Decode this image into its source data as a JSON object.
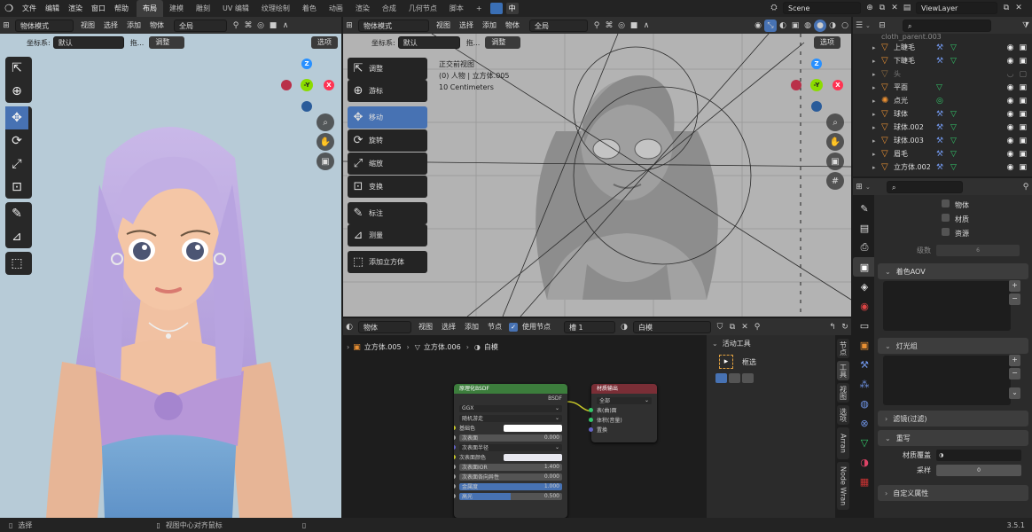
{
  "topbar": {
    "menus": [
      "文件",
      "编辑",
      "渲染",
      "窗口",
      "帮助"
    ],
    "workspaces": [
      "布局",
      "建模",
      "雕刻",
      "UV 编辑",
      "纹理绘制",
      "着色",
      "动画",
      "渲染",
      "合成",
      "几何节点",
      "脚本"
    ],
    "active_workspace": "布局",
    "lang_badge": "中",
    "scene": "Scene",
    "view_layer": "ViewLayer"
  },
  "viewport_left": {
    "mode": "物体模式",
    "menus": [
      "视图",
      "选择",
      "添加",
      "物体"
    ],
    "orientation": "全局",
    "coord_label": "坐标系:",
    "coord_value": "默认",
    "drag_label": "拖...",
    "adjust_label": "调整",
    "options_label": "选项",
    "gizmo": {
      "x": "X",
      "y": "Y",
      "z": "Z",
      "neg_y": "-Y"
    }
  },
  "viewport_right": {
    "mode": "物体模式",
    "menus": [
      "视图",
      "选择",
      "添加",
      "物体"
    ],
    "orientation": "全局",
    "coord_label": "坐标系:",
    "coord_value": "默认",
    "drag_label": "拖...",
    "adjust_label": "调整",
    "options_label": "选项",
    "info_line1": "正交前视图",
    "info_line2": "(0) 人物 | 立方体.005",
    "info_line3": "10 Centimeters",
    "tools": [
      "调整",
      "游标",
      "移动",
      "旋转",
      "缩放",
      "变换",
      "标注",
      "测量",
      "添加立方体"
    ],
    "active_tool": "移动"
  },
  "node_editor": {
    "editor_label": "物体",
    "menus": [
      "视图",
      "选择",
      "添加",
      "节点"
    ],
    "use_nodes": "使用节点",
    "slot": "槽 1",
    "material": "白模",
    "breadcrumb": [
      "立方体.005",
      "立方体.006",
      "白模"
    ],
    "bsdf": {
      "title": "原理化BSDF",
      "output": "BSDF",
      "distribution": "GGX",
      "subsurface_method": "随机游走",
      "base_color": "基础色",
      "subsurface": {
        "label": "次表面",
        "value": "0.000"
      },
      "subsurface_radius": "次表面半径",
      "subsurface_color": "次表面颜色",
      "subsurface_ior": {
        "label": "次表面IOR",
        "value": "1.400"
      },
      "subsurface_aniso": {
        "label": "次表面各向异性",
        "value": "0.000"
      },
      "metallic": {
        "label": "金属度",
        "value": "1.000"
      },
      "specular": {
        "label": "高光",
        "value": "0.500"
      }
    },
    "output_node": {
      "title": "材质输出",
      "target": "全部",
      "surface": "表(曲)面",
      "volume": "体积(音量)",
      "displacement": "置换"
    },
    "sidebar": {
      "title": "活动工具",
      "tool": "框选",
      "tabs": [
        "节点",
        "工具",
        "视图",
        "选项",
        "Arran",
        "Node Wran"
      ]
    }
  },
  "outliner": {
    "search_placeholder": "",
    "rows": [
      {
        "name": "cloth_parent.003",
        "faded": true
      },
      {
        "name": "上睫毛"
      },
      {
        "name": "下睫毛"
      },
      {
        "name": "头",
        "faded": true
      },
      {
        "name": "平面"
      },
      {
        "name": "点光"
      },
      {
        "name": "球体"
      },
      {
        "name": "球体.002"
      },
      {
        "name": "球体.003"
      },
      {
        "name": "眉毛"
      },
      {
        "name": "立方体.002"
      }
    ]
  },
  "properties": {
    "checkboxes": [
      "物体",
      "材质",
      "资源"
    ],
    "levels_label": "级数",
    "levels_value": "6",
    "sections": {
      "aov": "着色AOV",
      "light_group": "灯光组",
      "filter": "滤镜(过滤)",
      "override": "重写",
      "custom": "自定义属性"
    },
    "material_override": "材质覆盖",
    "samples_label": "采样",
    "samples_value": "0"
  },
  "statusbar": {
    "select": "选择",
    "center": "视图中心对齐鼠标",
    "version": "3.5.1"
  },
  "colors": {
    "accent": "#4772b3",
    "shader_header": "#3c7d3c",
    "output_header": "#7a2e36",
    "gizmo_x": "#ff3352",
    "gizmo_y": "#8bdc00",
    "gizmo_z": "#2890ff"
  }
}
